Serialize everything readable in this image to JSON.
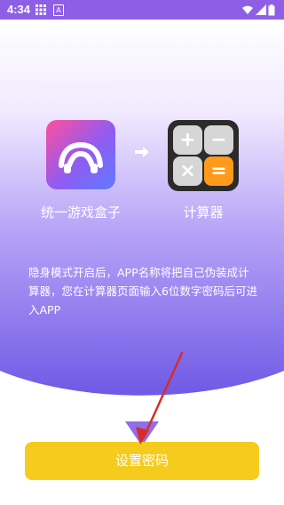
{
  "status_bar": {
    "time": "4:34",
    "left_icons": [
      "grid-icon",
      "a-icon"
    ],
    "right_icons": [
      "wifi-icon",
      "signal-icon",
      "battery-icon"
    ]
  },
  "hero": {
    "app_label": "统一游戏盒子",
    "calculator_label": "计算器",
    "calculator_keys": [
      "+",
      "−",
      "×",
      "="
    ],
    "description": "隐身模式开启后，APP名称将把自己伪装成计算器，您在计算器页面输入6位数字密码后可进入APP"
  },
  "primary_button": {
    "label": "设置密码"
  },
  "colors": {
    "accent_purple": "#8e5fe6",
    "button_yellow": "#f5cc1e",
    "annotation_red": "#d92b2b"
  }
}
